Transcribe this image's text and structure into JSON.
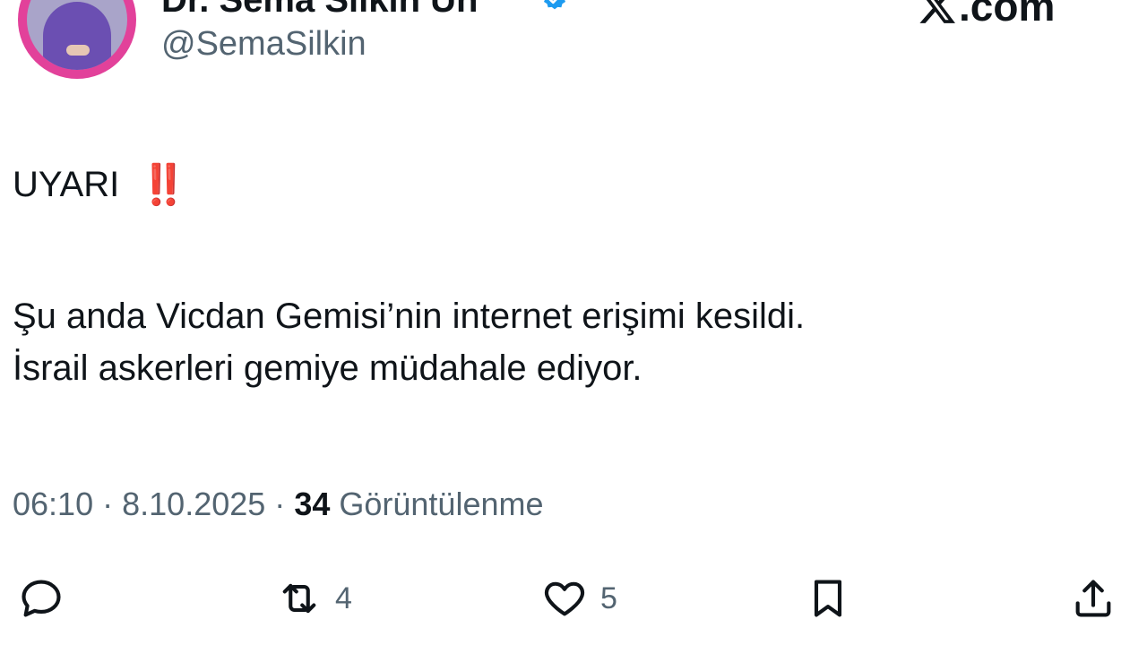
{
  "author": {
    "display_name": "Dr. Sema Silkin Ün",
    "handle": "@SemaSilkin",
    "verified": true
  },
  "brand": {
    "text": ".com",
    "icon": "x-logo-icon"
  },
  "tweet": {
    "alert_text": "UYARI",
    "alert_emoji": "‼️",
    "lines": [
      "Şu anda Vicdan Gemisi’nin internet erişimi kesildi.",
      "İsrail askerleri gemiye müdahale ediyor."
    ]
  },
  "meta": {
    "time": "06:10",
    "separator": "·",
    "date": "8.10.2025",
    "views_count": "34",
    "views_label": "Görüntülenme"
  },
  "actions": {
    "reply": {
      "icon": "reply-icon",
      "count": ""
    },
    "retweet": {
      "icon": "retweet-icon",
      "count": "4"
    },
    "like": {
      "icon": "heart-icon",
      "count": "5"
    },
    "bookmark": {
      "icon": "bookmark-icon",
      "count": ""
    },
    "share": {
      "icon": "share-icon",
      "count": ""
    }
  },
  "colors": {
    "text_primary": "#0f1419",
    "text_secondary": "#536471",
    "alert_red": "#d7261e",
    "verified_blue": "#1d9bf0",
    "avatar_ring": "#e2419a"
  }
}
